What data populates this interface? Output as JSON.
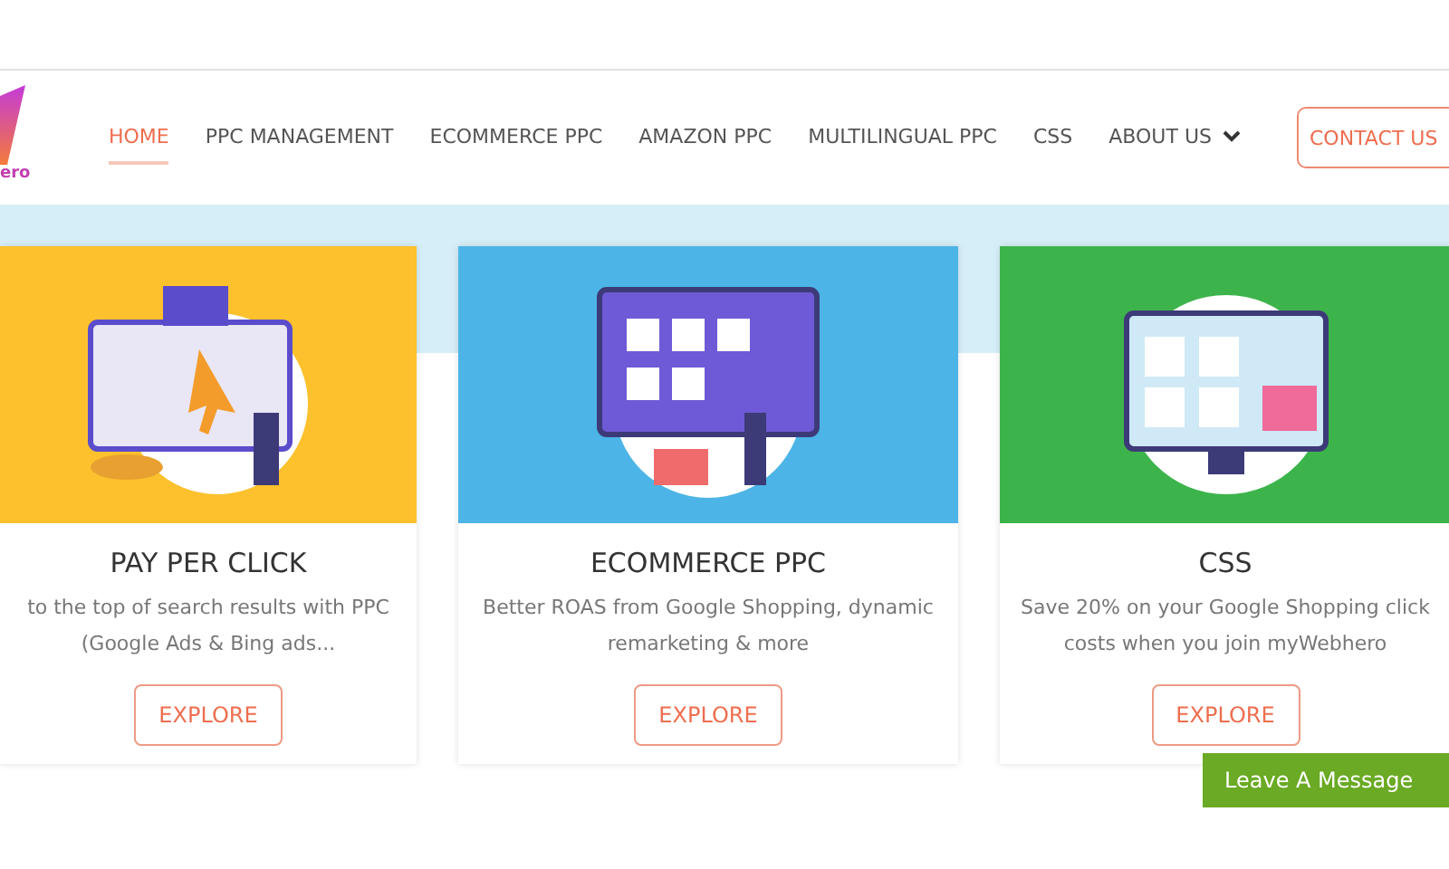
{
  "logo": {
    "text": "ero"
  },
  "nav": [
    {
      "label": "HOME",
      "selected": true,
      "kind": "link"
    },
    {
      "label": "PPC MANAGEMENT",
      "selected": false,
      "kind": "link"
    },
    {
      "label": "ECOMMERCE PPC",
      "selected": false,
      "kind": "link"
    },
    {
      "label": "AMAZON PPC",
      "selected": false,
      "kind": "link"
    },
    {
      "label": "MULTILINGUAL PPC",
      "selected": false,
      "kind": "link"
    },
    {
      "label": "CSS",
      "selected": false,
      "kind": "link"
    },
    {
      "label": "ABOUT US",
      "selected": false,
      "kind": "dropdown"
    }
  ],
  "contact_button": {
    "label": "CONTACT US"
  },
  "cards": [
    {
      "title": "PAY PER CLICK",
      "text": "to the top of search results with PPC (Google Ads & Bing ads...",
      "button": "EXPLORE",
      "color": "#fcc12d"
    },
    {
      "title": "ECOMMERCE PPC",
      "text": "Better ROAS from Google Shopping, dynamic remarketing & more",
      "button": "EXPLORE",
      "color": "#4cb4e6"
    },
    {
      "title": "CSS",
      "text": "Save 20% on your Google Shopping click costs when you join myWebhero",
      "button": "EXPLORE",
      "color": "#3db44b"
    }
  ],
  "chat_button": {
    "label": "Leave A Message"
  }
}
